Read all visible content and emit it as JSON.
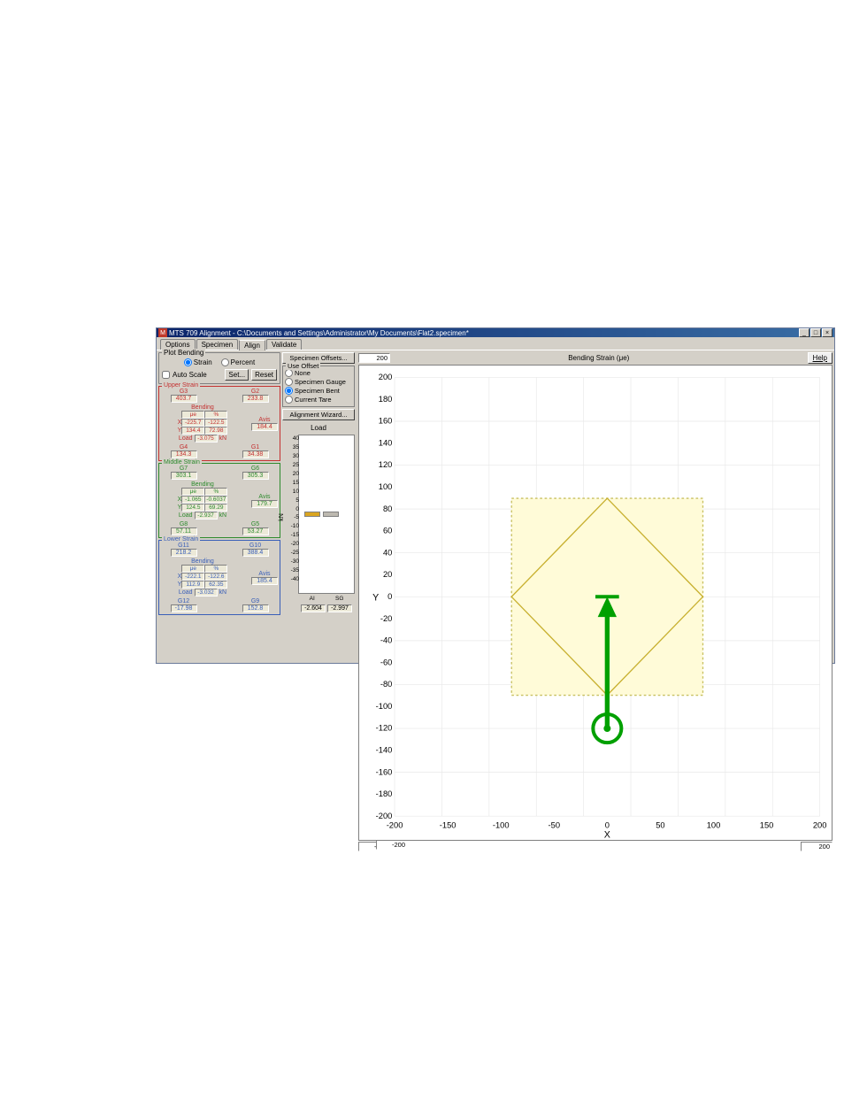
{
  "window_title": "MTS 709 Alignment - C:\\Documents and Settings\\Administrator\\My Documents\\Flat2.specimen*",
  "tabs": [
    "Options",
    "Specimen",
    "Align",
    "Validate"
  ],
  "active_tab": 2,
  "plot_bending": {
    "legend": "Plot Bending",
    "strain_label": "Strain",
    "percent_label": "Percent",
    "auto_scale_label": "Auto Scale",
    "set_btn": "Set...",
    "reset_btn": "Reset"
  },
  "mid": {
    "specimen_offsets_btn": "Specimen Offsets...",
    "use_offset_legend": "Use Offset",
    "offset_options": [
      "None",
      "Specimen Gauge",
      "Specimen Bent",
      "Current Tare"
    ],
    "offset_selected": 2,
    "alignment_wizard_btn": "Alignment Wizard...",
    "load_label": "Load",
    "load_y_ticks": [
      "40",
      "35",
      "30",
      "25",
      "20",
      "15",
      "10",
      "5",
      "0",
      "-5",
      "-10",
      "-15",
      "-20",
      "-25",
      "-30",
      "-35",
      "-40"
    ],
    "kn_label": "kN",
    "xaxis": [
      "AI",
      "SG"
    ],
    "bottom_vals": [
      "-2.604",
      "-2.997"
    ]
  },
  "upper": {
    "legend": "Upper Strain",
    "g3_label": "G3",
    "g3": "403.7",
    "g2_label": "G2",
    "g2": "233.8",
    "g4_label": "G4",
    "g4": "134.3",
    "g1_label": "G1",
    "g1": "34.38",
    "bending": "Bending",
    "ue": "μe",
    "pct": "%",
    "x": "X",
    "y": "Y",
    "x_ue": "-225.7",
    "x_pct": "-122.5",
    "y_ue": "134.4",
    "y_pct": "72.98",
    "avis": "Avis",
    "avis_val": "184.4",
    "load_label": "Load",
    "load_val": "-3.075",
    "load_unit": "kN"
  },
  "middle": {
    "legend": "Middle Strain",
    "g7_label": "G7",
    "g7": "303.1",
    "g6_label": "G6",
    "g6": "305.3",
    "g8_label": "G8",
    "g8": "57.11",
    "g5_label": "G5",
    "g5": "53.27",
    "bending": "Bending",
    "ue": "μe",
    "pct": "%",
    "x": "X",
    "y": "Y",
    "x_ue": "-1.065",
    "x_pct": "-0.6037",
    "y_ue": "124.5",
    "y_pct": "69.29",
    "avis": "Avis",
    "avis_val": "179.7",
    "load_label": "Load",
    "load_val": "-2.937",
    "load_unit": "kN"
  },
  "lower": {
    "legend": "Lower Strain",
    "g11_label": "G11",
    "g11": "218.2",
    "g10_label": "G10",
    "g10": "388.4",
    "g12_label": "G12",
    "g12": "-17.98",
    "g9_label": "G9",
    "g9": "152.8",
    "bending": "Bending",
    "ue": "μe",
    "pct": "%",
    "x": "X",
    "y": "Y",
    "x_ue": "-222.1",
    "x_pct": "-122.6",
    "y_ue": "112.9",
    "y_pct": "62.35",
    "avis": "Avis",
    "avis_val": "185.4",
    "load_label": "Load",
    "load_val": "-3.032",
    "load_unit": "kN"
  },
  "chart": {
    "title": "Bending Strain (μe)",
    "help": "Help",
    "y_top": "200",
    "y_bottom": "-200",
    "x_left": "-200",
    "x_right": "200",
    "xlabel": "X",
    "ylabel": "Y",
    "y_ticks": [
      "200",
      "180",
      "160",
      "140",
      "120",
      "100",
      "80",
      "60",
      "40",
      "20",
      "0",
      "-20",
      "-40",
      "-60",
      "-80",
      "-100",
      "-120",
      "-140",
      "-160",
      "-180",
      "-200"
    ],
    "x_ticks": [
      "-200",
      "-150",
      "-100",
      "-50",
      "0",
      "50",
      "100",
      "150",
      "200"
    ]
  },
  "chart_data": {
    "type": "scatter",
    "title": "Bending Strain (μe)",
    "xlabel": "X",
    "ylabel": "Y",
    "xlim": [
      -200,
      200
    ],
    "ylim": [
      -200,
      200
    ],
    "square": {
      "x_range": [
        -90,
        90
      ],
      "y_range": [
        -90,
        90
      ]
    },
    "diamond": {
      "radius": 90
    },
    "marker": {
      "x": 0,
      "y": -120
    },
    "arrow_to": {
      "x": 0,
      "y": 0
    }
  }
}
